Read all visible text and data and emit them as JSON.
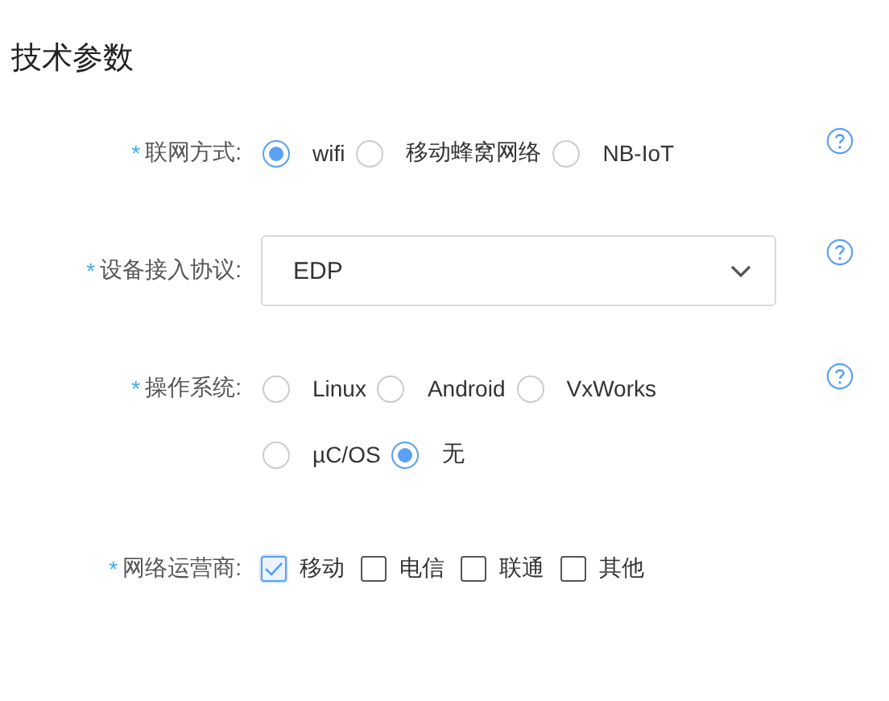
{
  "title": "技术参数",
  "fields": [
    {
      "kind": "radio",
      "mark": "*",
      "label": "联网方式:",
      "help": true,
      "options": [
        {
          "label": "wifi",
          "selected": true
        },
        {
          "label": "移动蜂窝网络",
          "selected": false
        },
        {
          "label": "NB-IoT",
          "selected": false
        }
      ]
    },
    {
      "kind": "select",
      "mark": "*",
      "label": "设备接入协议:",
      "help": true,
      "value": "EDP"
    },
    {
      "kind": "radio",
      "mark": "*",
      "label": "操作系统:",
      "help": true,
      "options": [
        {
          "label": "Linux",
          "selected": false
        },
        {
          "label": "Android",
          "selected": false
        },
        {
          "label": "VxWorks",
          "selected": false
        },
        {
          "label": "µC/OS",
          "selected": false
        },
        {
          "label": "无",
          "selected": true
        }
      ]
    },
    {
      "kind": "checkbox",
      "mark": "*",
      "label": "网络运营商:",
      "help": false,
      "options": [
        {
          "label": "移动",
          "checked": true
        },
        {
          "label": "电信",
          "checked": false
        },
        {
          "label": "联通",
          "checked": false
        },
        {
          "label": "其他",
          "checked": false
        }
      ]
    }
  ]
}
